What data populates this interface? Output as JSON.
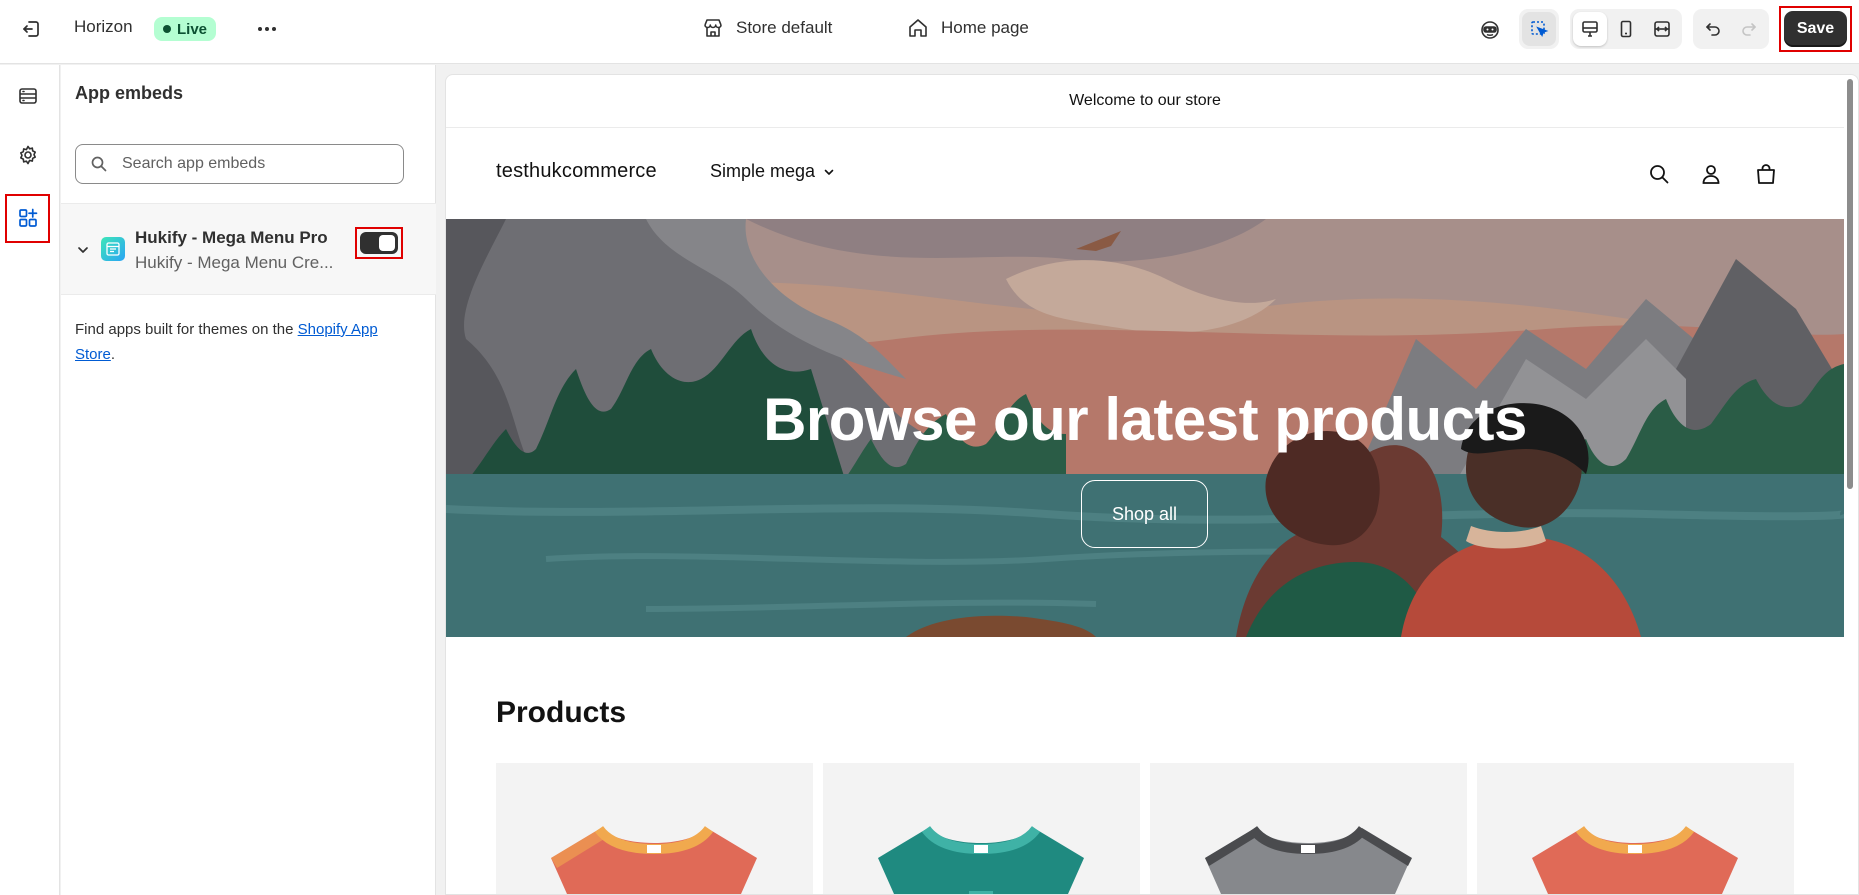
{
  "topbar": {
    "theme_name": "Horizon",
    "live_label": "Live",
    "template_label": "Store default",
    "page_label": "Home page",
    "save_label": "Save"
  },
  "sidebar": {
    "title": "App embeds",
    "search_placeholder": "Search app embeds",
    "embed": {
      "name": "Hukify - Mega Menu Pro",
      "subtitle": "Hukify - Mega Menu Cre...",
      "enabled": true
    },
    "find_text": "Find apps built for themes on the ",
    "find_link": "Shopify App Store",
    "find_suffix": "."
  },
  "store": {
    "announcement": "Welcome to our store",
    "logo": "testhukcommerce",
    "nav_item": "Simple mega",
    "hero_title": "Browse our latest products",
    "hero_button": "Shop all",
    "products_title": "Products"
  },
  "colors": {
    "save_bg": "#303030",
    "live_badge": "#b4fed2",
    "highlight": "#e00000",
    "link": "#005bd3"
  }
}
